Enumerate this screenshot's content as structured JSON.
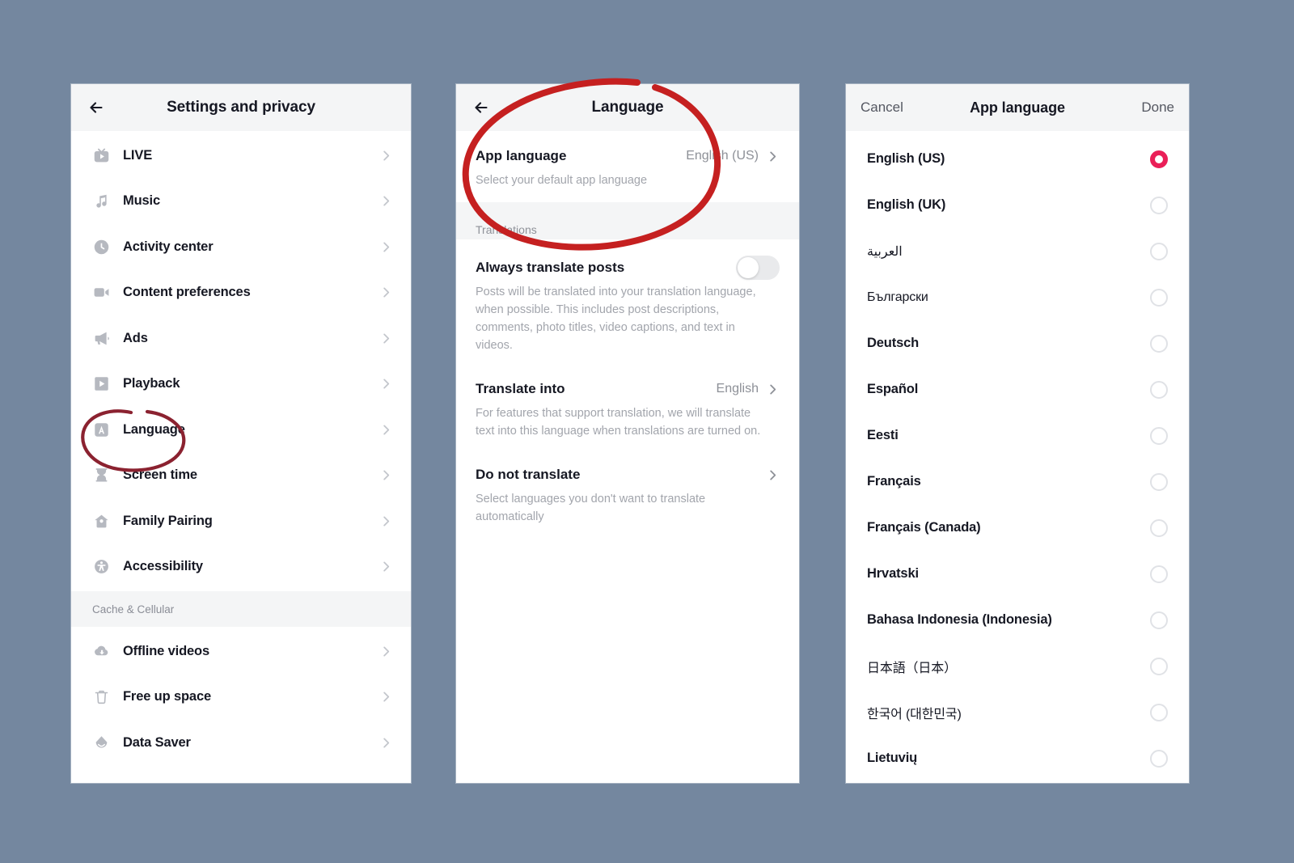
{
  "background_color": "#74879f",
  "accent_color": "#ea1f58",
  "annotation_colors": {
    "panel1_circle": "#8b2230",
    "panel2_circle": "#c52020"
  },
  "panels": {
    "settings": {
      "header": {
        "title": "Settings and privacy",
        "back_icon": "back-arrow-icon"
      },
      "groups": [
        {
          "label": "",
          "items": [
            {
              "label": "LIVE",
              "icon": "live-icon"
            },
            {
              "label": "Music",
              "icon": "music-note-icon"
            },
            {
              "label": "Activity center",
              "icon": "clock-icon"
            },
            {
              "label": "Content preferences",
              "icon": "video-camera-icon"
            },
            {
              "label": "Ads",
              "icon": "megaphone-icon"
            },
            {
              "label": "Playback",
              "icon": "play-square-icon"
            },
            {
              "label": "Language",
              "icon": "language-a-icon"
            },
            {
              "label": "Screen time",
              "icon": "hourglass-icon"
            },
            {
              "label": "Family Pairing",
              "icon": "house-icon"
            },
            {
              "label": "Accessibility",
              "icon": "accessibility-icon"
            }
          ]
        },
        {
          "label": "Cache & Cellular",
          "items": [
            {
              "label": "Offline videos",
              "icon": "cloud-download-icon"
            },
            {
              "label": "Free up space",
              "icon": "trash-icon"
            },
            {
              "label": "Data Saver",
              "icon": "data-saver-icon"
            }
          ]
        }
      ]
    },
    "language": {
      "header": {
        "title": "Language",
        "back_icon": "back-arrow-icon"
      },
      "app_language": {
        "title": "App language",
        "value": "English (US)",
        "subtitle": "Select your default app language"
      },
      "section_label": "Translations",
      "always_translate": {
        "title": "Always translate posts",
        "toggle_state": "off",
        "subtitle": "Posts will be translated into your translation language, when possible. This includes post descriptions, comments, photo titles, video captions, and text in videos."
      },
      "translate_into": {
        "title": "Translate into",
        "value": "English",
        "subtitle": "For features that support translation, we will translate text into this language when translations are turned on."
      },
      "do_not_translate": {
        "title": "Do not translate",
        "subtitle": "Select languages you don't want to translate automatically"
      }
    },
    "app_language": {
      "header": {
        "cancel_label": "Cancel",
        "title": "App language",
        "done_label": "Done"
      },
      "languages": [
        {
          "label": "English (US)",
          "selected": true
        },
        {
          "label": "English (UK)",
          "selected": false
        },
        {
          "label": "العربية",
          "selected": false
        },
        {
          "label": "Български",
          "selected": false
        },
        {
          "label": "Deutsch",
          "selected": false
        },
        {
          "label": "Español",
          "selected": false
        },
        {
          "label": "Eesti",
          "selected": false
        },
        {
          "label": "Français",
          "selected": false
        },
        {
          "label": "Français (Canada)",
          "selected": false
        },
        {
          "label": "Hrvatski",
          "selected": false
        },
        {
          "label": "Bahasa Indonesia (Indonesia)",
          "selected": false
        },
        {
          "label": "日本語（日本）",
          "selected": false
        },
        {
          "label": "한국어 (대한민국)",
          "selected": false
        },
        {
          "label": "Lietuvių",
          "selected": false
        }
      ]
    }
  }
}
